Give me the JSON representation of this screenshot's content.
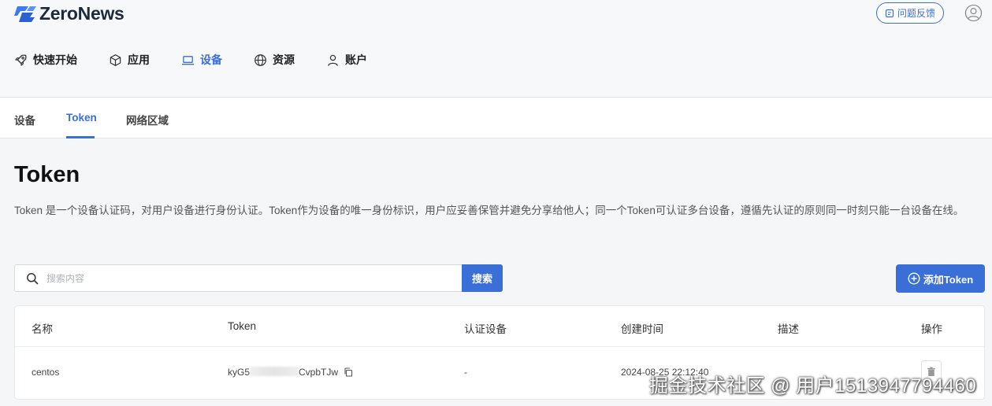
{
  "app": {
    "name": "ZeroNews",
    "feedback_label": "问题反馈"
  },
  "main_nav": [
    {
      "label": "快速开始",
      "icon": "rocket-icon"
    },
    {
      "label": "应用",
      "icon": "cube-icon"
    },
    {
      "label": "设备",
      "icon": "laptop-icon",
      "active": true
    },
    {
      "label": "资源",
      "icon": "globe-icon"
    },
    {
      "label": "账户",
      "icon": "user-icon"
    }
  ],
  "sub_tabs": [
    {
      "label": "设备"
    },
    {
      "label": "Token",
      "active": true
    },
    {
      "label": "网络区域"
    }
  ],
  "page": {
    "title": "Token",
    "description": "Token 是一个设备认证码，对用户设备进行身份认证。Token作为设备的唯一身份标识，用户应妥善保管并避免分享给他人；同一个Token可认证多台设备，遵循先认证的原则同一时刻只能一台设备在线。"
  },
  "search": {
    "placeholder": "搜索内容",
    "button_label": "搜索"
  },
  "add_button_label": "添加Token",
  "table": {
    "headers": [
      "名称",
      "Token",
      "认证设备",
      "创建时间",
      "描述",
      "操作"
    ],
    "rows": [
      {
        "name": "centos",
        "token_prefix": "kyG5",
        "token_suffix": "CvpbTJw",
        "device": "-",
        "created": "2024-08-25 22:12:40",
        "desc": ""
      }
    ]
  },
  "watermark": "掘金技术社区 @ 用户1513947794460",
  "colors": {
    "accent": "#3a6fd8",
    "background": "#f5f6f8"
  }
}
